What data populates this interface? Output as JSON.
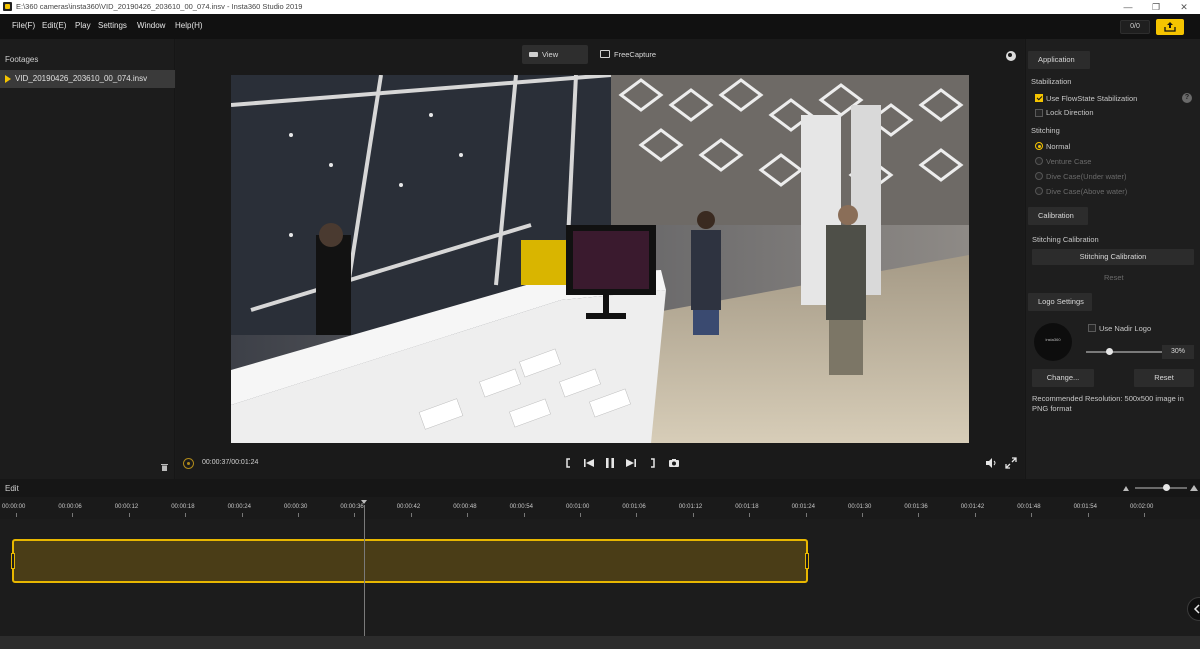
{
  "window": {
    "title": "E:\\360 cameras\\insta360\\VID_20190426_203610_00_074.insv - Insta360 Studio 2019",
    "controls": {
      "minimize": "—",
      "maximize": "❐",
      "close": "✕"
    }
  },
  "menu": {
    "items": [
      "File(F)",
      "Edit(E)",
      "Play",
      "Settings",
      "Window",
      "Help(H)"
    ],
    "counter": "0/0",
    "export_icon": "export-icon"
  },
  "left_panel": {
    "title": "Footages",
    "items": [
      {
        "name": "VID_20190426_203610_00_074.insv"
      }
    ],
    "trash_icon": "trash-icon"
  },
  "viewer": {
    "tabs": [
      "View",
      "FreeCapture"
    ],
    "active_tab": "View"
  },
  "playback": {
    "time": "00:00:37/00:01:24",
    "controls": [
      "mark-in",
      "previous",
      "pause",
      "next",
      "mark-out",
      "snapshot"
    ]
  },
  "right_panel": {
    "application_tab": "Application",
    "stabilization": {
      "title": "Stabilization",
      "use_flowstate": "Use FlowState Stabilization",
      "use_flowstate_checked": true,
      "lock_direction": "Lock Direction",
      "lock_direction_checked": false,
      "help": "?"
    },
    "stitching": {
      "title": "Stitching",
      "options": [
        "Normal",
        "Venture Case",
        "Dive Case(Under water)",
        "Dive Case(Above water)"
      ],
      "selected": "Normal"
    },
    "calibration": {
      "tab": "Calibration",
      "title": "Stitching Calibration",
      "button": "Stitching Calibration",
      "reset": "Reset"
    },
    "logo": {
      "tab": "Logo Settings",
      "use_nadir": "Use Nadir Logo",
      "use_nadir_checked": false,
      "logo_text": "insta360",
      "slider_percent": "30%",
      "slider_value": 0.3,
      "change_button": "Change...",
      "reset_button": "Reset",
      "recommendation": "Recommended Resolution: 500x500 image in PNG format"
    }
  },
  "edit": {
    "label": "Edit",
    "zoom_value": 0.6,
    "ruler_ticks": [
      "00:00:00",
      "00:00:06",
      "00:00:12",
      "00:00:18",
      "00:00:24",
      "00:00:30",
      "00:00:36",
      "00:00:42",
      "00:00:48",
      "00:00:54",
      "00:01:00",
      "00:01:06",
      "00:01:12",
      "00:01:18",
      "00:01:24",
      "00:01:30",
      "00:01:36",
      "00:01:42",
      "00:01:48",
      "00:01:54",
      "00:02:00"
    ],
    "clip_duration": "00:01:24",
    "playhead_time": "00:00:37"
  },
  "colors": {
    "accent": "#f5c400",
    "panel": "#1e1e1e",
    "clip_fill": "#4a3d17"
  }
}
